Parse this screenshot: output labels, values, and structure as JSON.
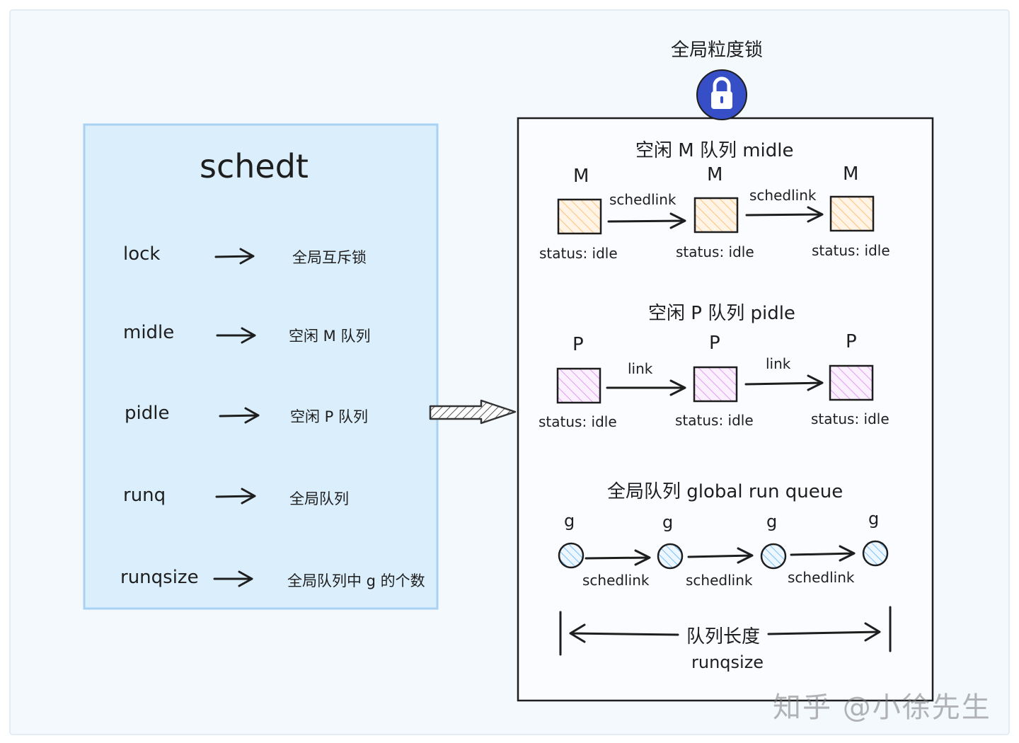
{
  "colors": {
    "background": "#f4f9fe",
    "panel_fill": "#dbeefc",
    "panel_stroke": "#a9d2f2",
    "m_node_fill": "#ffd8a8",
    "p_node_fill": "#eebefa",
    "g_node_fill": "#a5d8ff",
    "lock_fill": "#364fc7"
  },
  "schedt": {
    "title": "schedt",
    "fields": [
      {
        "name": "lock",
        "desc": "全局互斥锁"
      },
      {
        "name": "midle",
        "desc": "空闲 M 队列"
      },
      {
        "name": "pidle",
        "desc": "空闲 P 队列"
      },
      {
        "name": "runq",
        "desc": "全局队列"
      },
      {
        "name": "runqsize",
        "desc": "全局队列中 g 的个数"
      }
    ]
  },
  "lock": {
    "title": "全局粒度锁",
    "icon": "padlock-icon"
  },
  "midle": {
    "title": "空闲 M 队列 midle",
    "node_label": "M",
    "status": "status: idle",
    "link": "schedlink",
    "count": 3
  },
  "pidle": {
    "title": "空闲 P 队列 pidle",
    "node_label": "P",
    "status": "status: idle",
    "link": "link",
    "count": 3
  },
  "runq": {
    "title": "全局队列 global run queue",
    "node_label": "g",
    "link": "schedlink",
    "count": 4,
    "length_label": "队列长度",
    "size_label": "runqsize"
  },
  "watermark": "知乎 @小徐先生"
}
